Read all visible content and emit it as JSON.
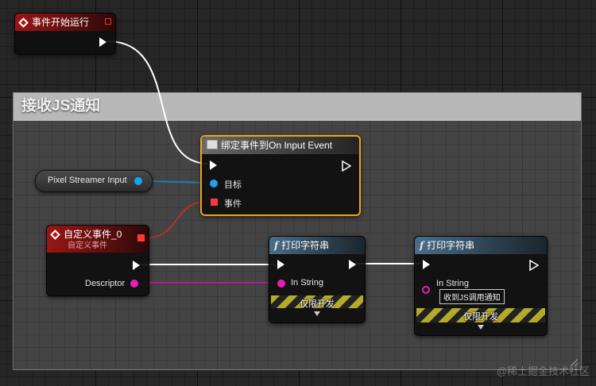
{
  "comment": {
    "title": "接收JS通知"
  },
  "begin_play": {
    "title": "事件开始运行"
  },
  "bind_event": {
    "title": "绑定事件到On Input Event",
    "target_label": "目标",
    "event_label": "事件"
  },
  "variable": {
    "label": "Pixel Streamer Input"
  },
  "custom_event": {
    "title": "自定义事件_0",
    "subtitle": "自定义事件",
    "descriptor_label": "Descriptor"
  },
  "print_string_1": {
    "title": "打印字符串",
    "in_string_label": "In String",
    "dev_only": "仅限开发"
  },
  "print_string_2": {
    "title": "打印字符串",
    "in_string_label": "In String",
    "in_string_value": "收到JS调用通知",
    "dev_only": "仅限开发"
  },
  "watermark": "@稀土掘金技术社区",
  "colors": {
    "exec": "#ffffff",
    "object": "#1aa3e8",
    "delegate": "#ff3838",
    "string": "#e81fb5",
    "selected": "#f0a020"
  }
}
